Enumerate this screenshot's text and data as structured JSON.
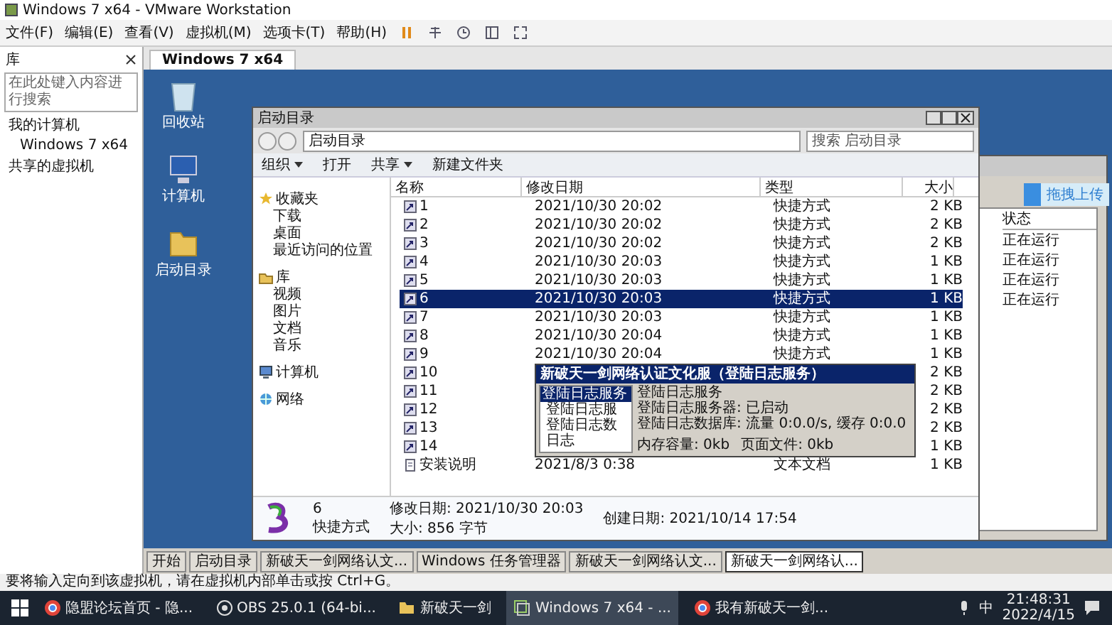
{
  "window": {
    "title": "Windows 7 x64 - VMware Workstation"
  },
  "menu": [
    "文件(F)",
    "编辑(E)",
    "查看(V)",
    "虚拟机(M)",
    "选项卡(T)",
    "帮助(H)"
  ],
  "library": {
    "title": "库",
    "search": {
      "placeholder": "在此处键入内容进行搜索"
    },
    "tree": [
      {
        "label": "我的计算机",
        "children": [
          {
            "label": "Windows 7 x64"
          }
        ]
      },
      {
        "label": "共享的虚拟机"
      }
    ]
  },
  "vm_tabs": [
    {
      "label": "Windows 7 x64",
      "selected": true
    }
  ],
  "desktop_icons": [
    {
      "label": "回收站",
      "kind": "recycle"
    },
    {
      "label": "计算机",
      "kind": "computer"
    },
    {
      "label": "启动目录",
      "kind": "folder"
    }
  ],
  "explorer": {
    "title": "启动目录",
    "address": "启动目录",
    "search": {
      "placeholder": "搜索 启动目录"
    },
    "toolbar": [
      {
        "label": "组织",
        "dropdown": true
      },
      {
        "label": "打开",
        "dropdown": false
      },
      {
        "label": "共享",
        "dropdown": true
      },
      {
        "label": "新建文件夹",
        "dropdown": false
      }
    ],
    "nav": [
      {
        "label": "收藏夹",
        "kind": "star",
        "items": [
          "下载",
          "桌面",
          "最近访问的位置"
        ]
      },
      {
        "label": "库",
        "kind": "library",
        "items": [
          "视频",
          "图片",
          "文档",
          "音乐"
        ]
      },
      {
        "label": "计算机",
        "kind": "computer"
      },
      {
        "label": "网络",
        "kind": "network"
      }
    ],
    "columns": [
      "名称",
      "修改日期",
      "类型",
      "大小"
    ],
    "rows": [
      {
        "name": "1",
        "date": "2021/10/30 20:02",
        "type": "快捷方式",
        "size": "2 KB",
        "kind": "shortcut",
        "selected": false
      },
      {
        "name": "2",
        "date": "2021/10/30 20:02",
        "type": "快捷方式",
        "size": "2 KB",
        "kind": "shortcut",
        "selected": false
      },
      {
        "name": "3",
        "date": "2021/10/30 20:02",
        "type": "快捷方式",
        "size": "2 KB",
        "kind": "shortcut",
        "selected": false
      },
      {
        "name": "4",
        "date": "2021/10/30 20:03",
        "type": "快捷方式",
        "size": "1 KB",
        "kind": "shortcut",
        "selected": false
      },
      {
        "name": "5",
        "date": "2021/10/30 20:03",
        "type": "快捷方式",
        "size": "1 KB",
        "kind": "shortcut",
        "selected": false
      },
      {
        "name": "6",
        "date": "2021/10/30 20:03",
        "type": "快捷方式",
        "size": "1 KB",
        "kind": "shortcut",
        "selected": true
      },
      {
        "name": "7",
        "date": "2021/10/30 20:03",
        "type": "快捷方式",
        "size": "1 KB",
        "kind": "shortcut",
        "selected": false
      },
      {
        "name": "8",
        "date": "2021/10/30 20:04",
        "type": "快捷方式",
        "size": "1 KB",
        "kind": "shortcut",
        "selected": false
      },
      {
        "name": "9",
        "date": "2021/10/30 20:04",
        "type": "快捷方式",
        "size": "1 KB",
        "kind": "shortcut",
        "selected": false
      },
      {
        "name": "10",
        "size": "2 KB",
        "kind": "shortcut",
        "selected": false
      },
      {
        "name": "11",
        "size": "2 KB",
        "kind": "shortcut",
        "selected": false
      },
      {
        "name": "12",
        "size": "2 KB",
        "kind": "shortcut",
        "selected": false
      },
      {
        "name": "13",
        "size": "2 KB",
        "kind": "shortcut",
        "selected": false
      },
      {
        "name": "14",
        "size": "1 KB",
        "kind": "shortcut",
        "selected": false
      },
      {
        "name": "安装说明",
        "date": "2021/8/3 0:38",
        "type": "文本文档",
        "size": "1 KB",
        "kind": "text",
        "selected": false
      }
    ],
    "details": {
      "name": "6",
      "modified": "修改日期: 2021/10/30 20:03",
      "created": "创建日期: 2021/10/14 17:54",
      "type": "快捷方式",
      "size": "大小: 856 字节"
    }
  },
  "dialog": {
    "title": "新破天一剑网络认证文化服（登陆日志服务）",
    "tree": [
      {
        "label": "登陆日志服务",
        "selected": true,
        "children": [
          {
            "label": "登陆日志服",
            "selected": false
          },
          {
            "label": "登陆日志数",
            "selected": false
          },
          {
            "label": "日志",
            "selected": false
          }
        ]
      }
    ],
    "info": [
      "登陆日志服务",
      "登陆日志服务器: 已启动",
      "登陆日志数据库: 流量 0:0.0/s, 缓存 0:0.0"
    ],
    "footer": [
      "内存容量: 0kb",
      "页面文件: 0kb"
    ]
  },
  "back_window": {
    "column": "状态",
    "rows": [
      "正在运行",
      "正在运行",
      "正在运行",
      "正在运行"
    ]
  },
  "upload_badge": "拖拽上传",
  "vm_taskbar": {
    "start": "开始",
    "items": [
      {
        "label": "启动目录",
        "selected": false
      },
      {
        "label": "新破天一剑网络认文...",
        "selected": false
      },
      {
        "label": "Windows 任务管理器",
        "selected": false
      },
      {
        "label": "新破天一剑网络认文...",
        "selected": false
      },
      {
        "label": "新破天一剑网络认...",
        "selected": true
      }
    ]
  },
  "status_bar": "要将输入定向到该虚拟机，请在虚拟机内部单击或按 Ctrl+G。",
  "host_taskbar": {
    "items": [
      {
        "label": "隐盟论坛首页 - 隐...",
        "kind": "browser",
        "selected": false
      },
      {
        "label": "OBS 25.0.1 (64-bi...",
        "kind": "obs",
        "selected": false
      },
      {
        "label": "新破天一剑",
        "kind": "folder",
        "selected": false
      },
      {
        "label": "Windows 7 x64 - ...",
        "kind": "vmware",
        "selected": true
      },
      {
        "label": "我有新破天一剑...",
        "kind": "browser",
        "selected": false
      }
    ],
    "ime": "中",
    "time": "21:48:31",
    "date": "2022/4/15"
  }
}
